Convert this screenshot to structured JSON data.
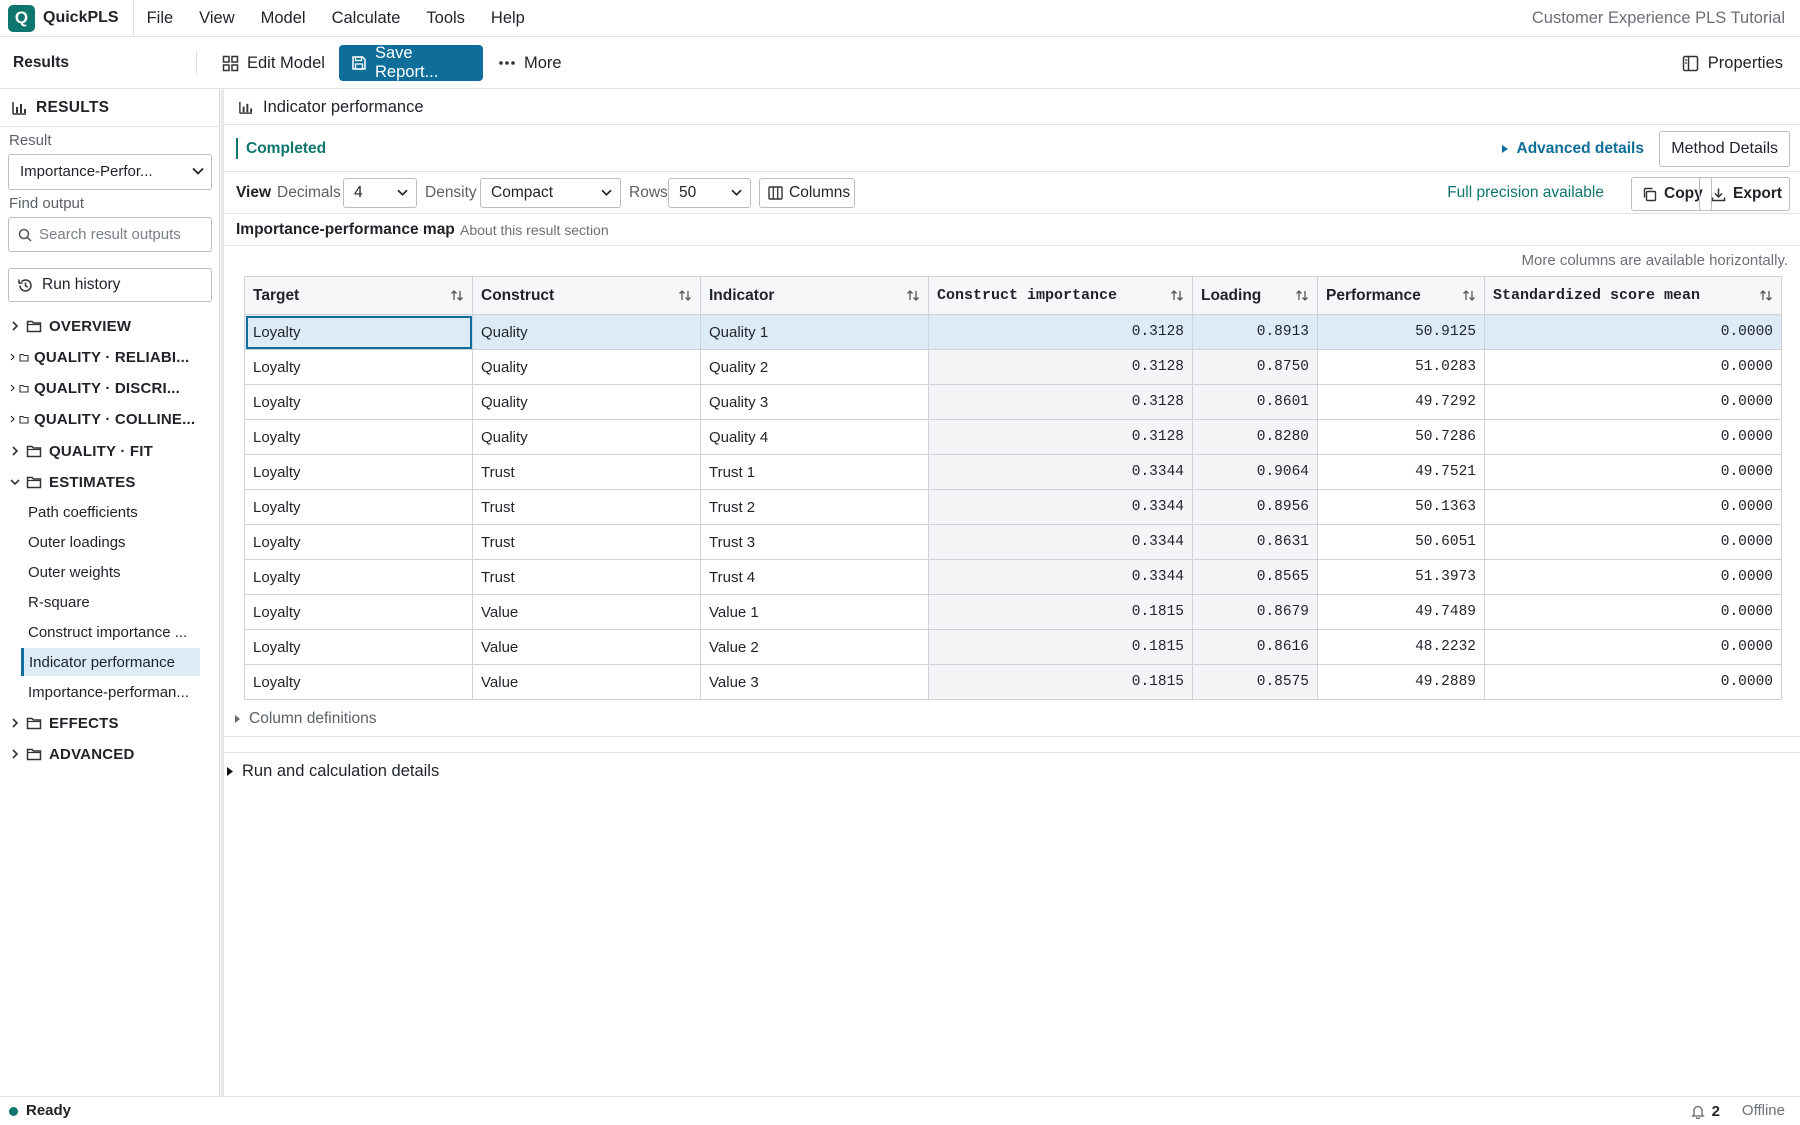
{
  "app": {
    "logo_letter": "Q",
    "name": "QuickPLS",
    "project_title": "Customer Experience PLS Tutorial"
  },
  "menu": [
    "File",
    "View",
    "Model",
    "Calculate",
    "Tools",
    "Help"
  ],
  "toolbar": {
    "section": "Results",
    "edit_model": "Edit Model",
    "save_report": "Save Report...",
    "more": "More",
    "properties": "Properties",
    "primary_color": "#0e6e99"
  },
  "sidebar": {
    "header": "RESULTS",
    "result_label": "Result",
    "result_value": "Importance-Perfor...",
    "find_label": "Find output",
    "search_placeholder": "Search result outputs",
    "run_history": "Run history",
    "groups": [
      {
        "label": "OVERVIEW",
        "state": "collapsed"
      },
      {
        "label": "QUALITY · RELIABI...",
        "state": "collapsed"
      },
      {
        "label": "QUALITY · DISCRI...",
        "state": "collapsed"
      },
      {
        "label": "QUALITY · COLLINE...",
        "state": "collapsed"
      },
      {
        "label": "QUALITY · FIT",
        "state": "collapsed"
      },
      {
        "label": "ESTIMATES",
        "state": "expanded"
      },
      {
        "label": "EFFECTS",
        "state": "collapsed"
      },
      {
        "label": "ADVANCED",
        "state": "collapsed"
      }
    ],
    "estimates_items": [
      "Path coefficients",
      "Outer loadings",
      "Outer weights",
      "R-square",
      "Construct importance ...",
      "Indicator performance",
      "Importance-performan..."
    ],
    "active_item": "Indicator performance"
  },
  "main": {
    "title": "Indicator performance",
    "status": "Completed",
    "advanced_details": "Advanced details",
    "method_details": "Method Details",
    "view": {
      "label": "View",
      "decimals_label": "Decimals",
      "decimals_value": "4",
      "density_label": "Density",
      "density_value": "Compact",
      "rows_label": "Rows",
      "rows_value": "50",
      "columns_button": "Columns",
      "precision_note": "Full precision available",
      "copy": "Copy",
      "export": "Export"
    },
    "section_title": "Importance-performance map",
    "section_about": "About this result section",
    "more_columns_note": "More columns are available horizontally.",
    "table": {
      "columns": [
        "Target",
        "Construct",
        "Indicator",
        "Construct importance",
        "Loading",
        "Performance",
        "Standardized score mean"
      ],
      "rows": [
        [
          "Loyalty",
          "Quality",
          "Quality 1",
          "0.3128",
          "0.8913",
          "50.9125",
          "0.0000"
        ],
        [
          "Loyalty",
          "Quality",
          "Quality 2",
          "0.3128",
          "0.8750",
          "51.0283",
          "0.0000"
        ],
        [
          "Loyalty",
          "Quality",
          "Quality 3",
          "0.3128",
          "0.8601",
          "49.7292",
          "0.0000"
        ],
        [
          "Loyalty",
          "Quality",
          "Quality 4",
          "0.3128",
          "0.8280",
          "50.7286",
          "0.0000"
        ],
        [
          "Loyalty",
          "Trust",
          "Trust 1",
          "0.3344",
          "0.9064",
          "49.7521",
          "0.0000"
        ],
        [
          "Loyalty",
          "Trust",
          "Trust 2",
          "0.3344",
          "0.8956",
          "50.1363",
          "0.0000"
        ],
        [
          "Loyalty",
          "Trust",
          "Trust 3",
          "0.3344",
          "0.8631",
          "50.6051",
          "0.0000"
        ],
        [
          "Loyalty",
          "Trust",
          "Trust 4",
          "0.3344",
          "0.8565",
          "51.3973",
          "0.0000"
        ],
        [
          "Loyalty",
          "Value",
          "Value 1",
          "0.1815",
          "0.8679",
          "49.7489",
          "0.0000"
        ],
        [
          "Loyalty",
          "Value",
          "Value 2",
          "0.1815",
          "0.8616",
          "48.2232",
          "0.0000"
        ],
        [
          "Loyalty",
          "Value",
          "Value 3",
          "0.1815",
          "0.8575",
          "49.2889",
          "0.0000"
        ]
      ]
    },
    "column_definitions": "Column definitions",
    "run_details": "Run and calculation details"
  },
  "statusbar": {
    "ready": "Ready",
    "notification_count": "2",
    "offline": "Offline"
  }
}
